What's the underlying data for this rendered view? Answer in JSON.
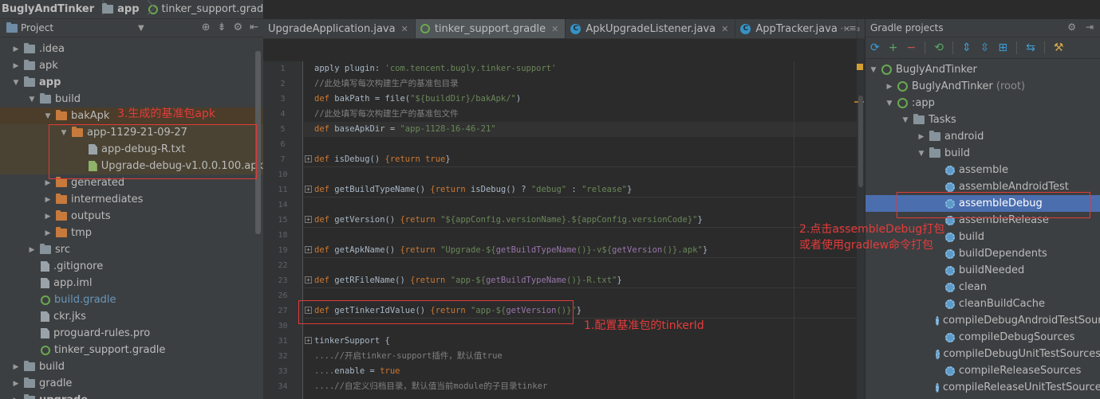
{
  "breadcrumb": {
    "project": "BuglyAndTinker",
    "module": "app",
    "file": "tinker_support.gradle"
  },
  "project_panel": {
    "title": "Project",
    "icons": [
      "target-icon",
      "collapse-icon",
      "gear-icon",
      "hide-icon"
    ],
    "tree": [
      {
        "label": ".idea",
        "indent": 1,
        "arrow": "right",
        "icon": "folder"
      },
      {
        "label": "apk",
        "indent": 1,
        "arrow": "right",
        "icon": "folder"
      },
      {
        "label": "app",
        "indent": 1,
        "arrow": "down",
        "icon": "module-folder",
        "bold": true
      },
      {
        "label": "build",
        "indent": 2,
        "arrow": "down",
        "icon": "folder"
      },
      {
        "label": "bakApk",
        "indent": 3,
        "arrow": "down",
        "icon": "folder-orange"
      },
      {
        "label": "app-1129-21-09-27",
        "indent": 4,
        "arrow": "down",
        "icon": "folder-orange"
      },
      {
        "label": "app-debug-R.txt",
        "indent": 5,
        "arrow": "",
        "icon": "file"
      },
      {
        "label": "Upgrade-debug-v1.0.0.100.apk",
        "indent": 5,
        "arrow": "",
        "icon": "apk"
      },
      {
        "label": "generated",
        "indent": 3,
        "arrow": "right",
        "icon": "folder-orange"
      },
      {
        "label": "intermediates",
        "indent": 3,
        "arrow": "right",
        "icon": "folder-orange"
      },
      {
        "label": "outputs",
        "indent": 3,
        "arrow": "right",
        "icon": "folder-orange"
      },
      {
        "label": "tmp",
        "indent": 3,
        "arrow": "right",
        "icon": "folder-orange"
      },
      {
        "label": "src",
        "indent": 2,
        "arrow": "right",
        "icon": "folder"
      },
      {
        "label": ".gitignore",
        "indent": 2,
        "arrow": "",
        "icon": "file"
      },
      {
        "label": "app.iml",
        "indent": 2,
        "arrow": "",
        "icon": "file"
      },
      {
        "label": "build.gradle",
        "indent": 2,
        "arrow": "",
        "icon": "gradle",
        "link": true
      },
      {
        "label": "ckr.jks",
        "indent": 2,
        "arrow": "",
        "icon": "file"
      },
      {
        "label": "proguard-rules.pro",
        "indent": 2,
        "arrow": "",
        "icon": "file"
      },
      {
        "label": "tinker_support.gradle",
        "indent": 2,
        "arrow": "",
        "icon": "gradle"
      },
      {
        "label": "build",
        "indent": 1,
        "arrow": "right",
        "icon": "folder"
      },
      {
        "label": "gradle",
        "indent": 1,
        "arrow": "right",
        "icon": "folder"
      },
      {
        "label": "upgrade",
        "indent": 1,
        "arrow": "right",
        "icon": "folder",
        "bold": true
      }
    ]
  },
  "tabs": [
    {
      "label": "UpgradeApplication.java",
      "icon": "class-icon",
      "active": false
    },
    {
      "label": "tinker_support.gradle",
      "icon": "gradle-icon",
      "active": true
    },
    {
      "label": "ApkUpgradeListener.java",
      "icon": "class-icon",
      "active": false
    },
    {
      "label": "AppTracker.java",
      "icon": "class-icon",
      "active": false
    }
  ],
  "tab_menu": "⋯≡₃",
  "code_lines": [
    {
      "n": "1",
      "html": [
        [
          "fn",
          "apply plugin: "
        ],
        [
          "str",
          "'com.tencent.bugly.tinker-support'"
        ]
      ]
    },
    {
      "n": "2",
      "html": [
        [
          "cm",
          "//此处填写每次构建生产的基准包目录"
        ]
      ]
    },
    {
      "n": "3",
      "html": [
        [
          "kw",
          "def "
        ],
        [
          "fn",
          "bakPath = file("
        ],
        [
          "str",
          "\"${buildDir}/bakApk/\""
        ],
        [
          "fn",
          ")"
        ]
      ]
    },
    {
      "n": "4",
      "html": [
        [
          "cm",
          "//此处填写每次构建生产的基准包文件"
        ]
      ]
    },
    {
      "n": "5",
      "html": [
        [
          "kw",
          "def "
        ],
        [
          "fn",
          "baseApkDir = "
        ],
        [
          "str",
          "\"app-1128-16-46-21\""
        ]
      ],
      "current": true
    },
    {
      "n": "6",
      "html": []
    },
    {
      "n": "7",
      "html": [
        [
          "kw",
          "def "
        ],
        [
          "fn",
          "isDebug() "
        ],
        [
          "kw",
          "{return true"
        ],
        [
          "fn",
          "}"
        ]
      ],
      "fold": true,
      "sep": true
    },
    {
      "n": "10",
      "html": []
    },
    {
      "n": "11",
      "html": [
        [
          "kw",
          "def "
        ],
        [
          "fn",
          "getBuildTypeName() "
        ],
        [
          "kw",
          "{return "
        ],
        [
          "fn",
          "isDebug() ? "
        ],
        [
          "str",
          "\"debug\""
        ],
        [
          "fn",
          " : "
        ],
        [
          "str",
          "\"release\""
        ],
        [
          "fn",
          "}"
        ]
      ],
      "fold": true,
      "sep": true
    },
    {
      "n": "14",
      "html": []
    },
    {
      "n": "15",
      "html": [
        [
          "kw",
          "def "
        ],
        [
          "fn",
          "getVersion() "
        ],
        [
          "kw",
          "{return "
        ],
        [
          "str",
          "\"${appConfig.versionName}.${appConfig.versionCode}\""
        ],
        [
          "fn",
          "}"
        ]
      ],
      "fold": true,
      "sep": true
    },
    {
      "n": "18",
      "html": []
    },
    {
      "n": "19",
      "html": [
        [
          "kw",
          "def "
        ],
        [
          "fn",
          "getApkName() "
        ],
        [
          "kw",
          "{return "
        ],
        [
          "str",
          "\"Upgrade-${"
        ],
        [
          "strexp",
          "getBuildTypeName"
        ],
        [
          "str",
          "()}-v${"
        ],
        [
          "strexp",
          "getVersion"
        ],
        [
          "str",
          "()}.apk\""
        ],
        [
          "fn",
          "}"
        ]
      ],
      "fold": true,
      "sep": true
    },
    {
      "n": "22",
      "html": []
    },
    {
      "n": "23",
      "html": [
        [
          "kw",
          "def "
        ],
        [
          "fn",
          "getRFileName() "
        ],
        [
          "kw",
          "{return "
        ],
        [
          "str",
          "\"app-${"
        ],
        [
          "strexp",
          "getBuildTypeName"
        ],
        [
          "str",
          "()}-R.txt\""
        ],
        [
          "fn",
          "}"
        ]
      ],
      "fold": true,
      "sep": true
    },
    {
      "n": "26",
      "html": []
    },
    {
      "n": "27",
      "html": [
        [
          "kw",
          "def "
        ],
        [
          "fn",
          "getTinkerIdValue() "
        ],
        [
          "kw",
          "{return "
        ],
        [
          "str",
          "\"app-${"
        ],
        [
          "strexp",
          "getVersion"
        ],
        [
          "str",
          "()}\""
        ],
        [
          "fn",
          "}"
        ]
      ],
      "fold": true,
      "sep": true
    },
    {
      "n": "30",
      "html": []
    },
    {
      "n": "31",
      "html": [
        [
          "fn",
          "tinkerSupport {"
        ]
      ],
      "fold": true
    },
    {
      "n": "32",
      "html": [
        [
          "cm",
          "....//开启tinker-support插件，默认值true"
        ]
      ]
    },
    {
      "n": "33",
      "html": [
        [
          "cm",
          "...."
        ],
        [
          "fn",
          "enable = "
        ],
        [
          "kw",
          "true"
        ]
      ]
    },
    {
      "n": "34",
      "html": [
        [
          "cm",
          "....//自定义归档目录，默认值当前module的子目录tinker"
        ]
      ]
    }
  ],
  "gradle_panel": {
    "title": "Gradle projects",
    "tree": [
      {
        "label": "BuglyAndTinker",
        "indent": 0,
        "arrow": "down",
        "icon": "gradle-app"
      },
      {
        "label": "BuglyAndTinker",
        "muted": "(root)",
        "indent": 1,
        "arrow": "right",
        "icon": "gradle-app"
      },
      {
        "label": ":app",
        "indent": 1,
        "arrow": "down",
        "icon": "gradle-app"
      },
      {
        "label": "Tasks",
        "indent": 2,
        "arrow": "down",
        "icon": "folder"
      },
      {
        "label": "android",
        "indent": 3,
        "arrow": "right",
        "icon": "folder"
      },
      {
        "label": "build",
        "indent": 3,
        "arrow": "down",
        "icon": "folder"
      },
      {
        "label": "assemble",
        "indent": 4,
        "arrow": "",
        "icon": "gear"
      },
      {
        "label": "assembleAndroidTest",
        "indent": 4,
        "arrow": "",
        "icon": "gear"
      },
      {
        "label": "assembleDebug",
        "indent": 4,
        "arrow": "",
        "icon": "gear",
        "selected": true
      },
      {
        "label": "assembleRelease",
        "indent": 4,
        "arrow": "",
        "icon": "gear"
      },
      {
        "label": "build",
        "indent": 4,
        "arrow": "",
        "icon": "gear"
      },
      {
        "label": "buildDependents",
        "indent": 4,
        "arrow": "",
        "icon": "gear"
      },
      {
        "label": "buildNeeded",
        "indent": 4,
        "arrow": "",
        "icon": "gear"
      },
      {
        "label": "clean",
        "indent": 4,
        "arrow": "",
        "icon": "gear"
      },
      {
        "label": "cleanBuildCache",
        "indent": 4,
        "arrow": "",
        "icon": "gear"
      },
      {
        "label": "compileDebugAndroidTestSources",
        "indent": 4,
        "arrow": "",
        "icon": "gear"
      },
      {
        "label": "compileDebugSources",
        "indent": 4,
        "arrow": "",
        "icon": "gear"
      },
      {
        "label": "compileDebugUnitTestSources",
        "indent": 4,
        "arrow": "",
        "icon": "gear"
      },
      {
        "label": "compileReleaseSources",
        "indent": 4,
        "arrow": "",
        "icon": "gear"
      },
      {
        "label": "compileReleaseUnitTestSources",
        "indent": 4,
        "arrow": "",
        "icon": "gear"
      }
    ]
  },
  "annotations": {
    "note1": "1.配置基准包的tinkerId",
    "note2_line1": "2.点击assembleDebug打包",
    "note2_line2": "或者使用gradlew命令打包",
    "note3": "3.生成的基准包apk"
  },
  "colors": {
    "annotation": "#e53b3b",
    "selection": "#4b6eaf",
    "keyword": "#cc7832",
    "string": "#6a8759"
  }
}
